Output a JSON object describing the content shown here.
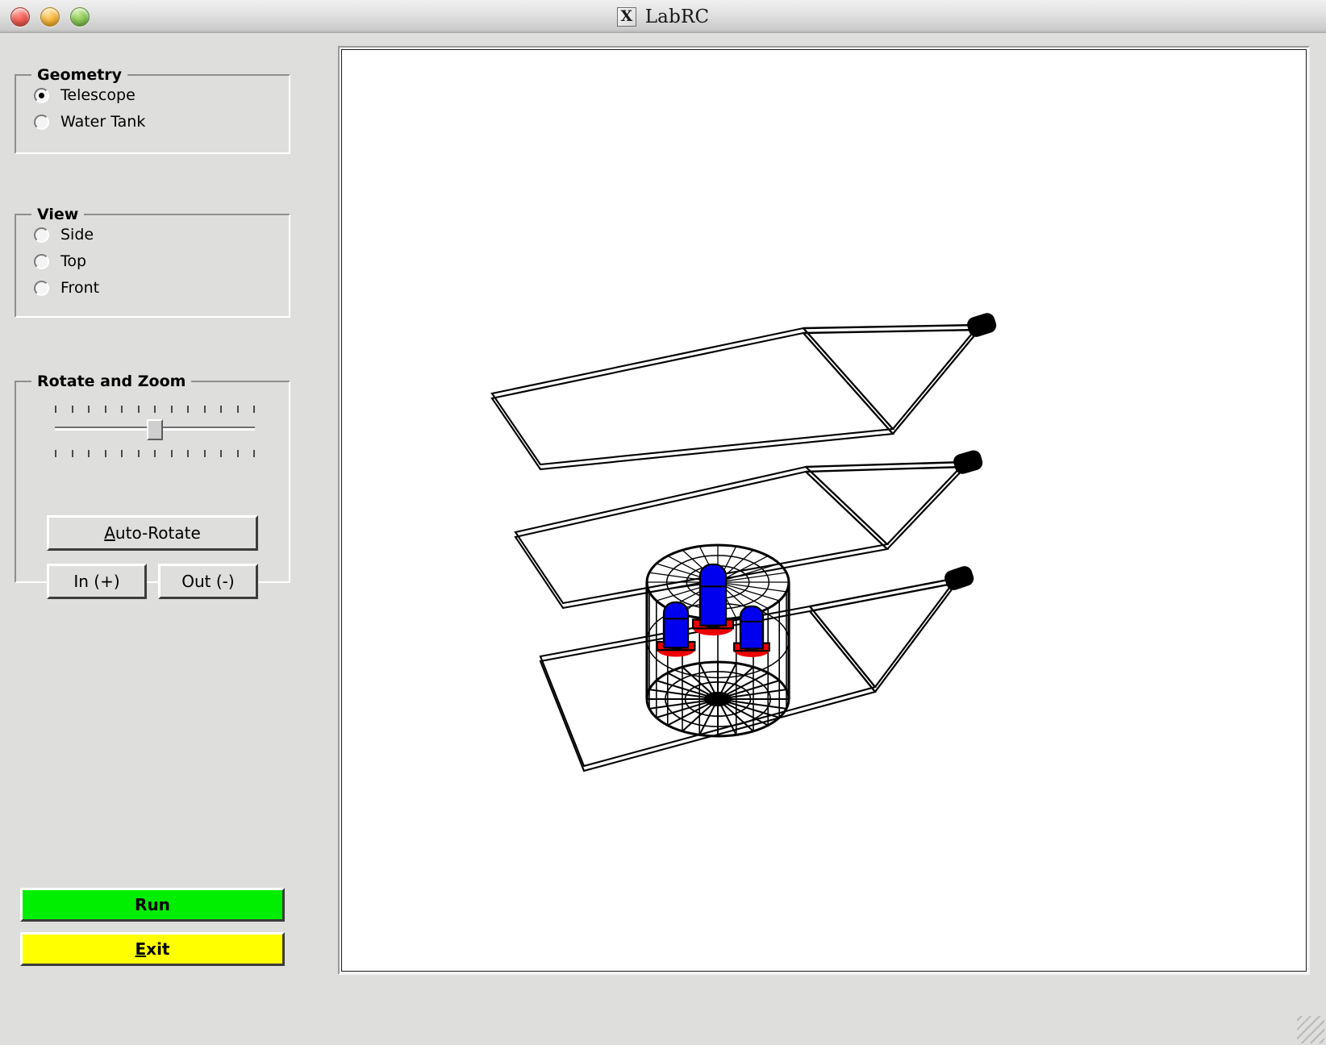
{
  "window": {
    "title": "LabRC",
    "app_icon": "x11-icon",
    "icon_glyph": "X",
    "traffic_lights": [
      {
        "name": "close-button",
        "color": "#ef5f55"
      },
      {
        "name": "minimize-button",
        "color": "#f5b53c"
      },
      {
        "name": "maximize-button",
        "color": "#8cc757"
      }
    ]
  },
  "panel": {
    "geometry": {
      "title": "Geometry",
      "options": [
        {
          "label": "Telescope",
          "selected": true
        },
        {
          "label": "Water Tank",
          "selected": false
        }
      ]
    },
    "view": {
      "title": "View",
      "options": [
        {
          "label": "Side",
          "selected": false
        },
        {
          "label": "Top",
          "selected": false
        },
        {
          "label": "Front",
          "selected": false
        }
      ]
    },
    "rotate_zoom": {
      "title": "Rotate and Zoom",
      "slider": {
        "name": "rotate-zoom-slider",
        "tick_count": 13,
        "value_percent": 50
      },
      "auto_rotate": {
        "label": "Auto-Rotate",
        "mnemonic": "A"
      },
      "zoom_in": {
        "label": "In (+)"
      },
      "zoom_out": {
        "label": "Out (-)"
      }
    },
    "actions": {
      "run": {
        "label": "Run",
        "color": "#00ee00"
      },
      "exit": {
        "label": "Exit",
        "mnemonic": "E",
        "color": "#ffff00"
      }
    }
  },
  "viewport": {
    "name": "3d-scene-canvas",
    "background": "#ffffff",
    "line_color": "#000000",
    "description": "Wireframe 3D view of three fluorescence telescopes and a water-Cherenkov tank",
    "objects": {
      "telescopes": [
        {
          "name": "telescope-upper",
          "mirror_color": "#000000",
          "camera_color": "#000000"
        },
        {
          "name": "telescope-middle",
          "mirror_color": "#000000",
          "camera_color": "#000000"
        },
        {
          "name": "telescope-lower",
          "mirror_color": "#000000",
          "camera_color": "#000000"
        }
      ],
      "water_tank": {
        "name": "water-tank-cylinder",
        "wire_color": "#000000",
        "pmts": [
          {
            "name": "pmt-left",
            "tube_color": "#0000ee",
            "base_color": "#ee0000"
          },
          {
            "name": "pmt-center",
            "tube_color": "#0000ee",
            "base_color": "#ee0000"
          },
          {
            "name": "pmt-right",
            "tube_color": "#0000ee",
            "base_color": "#ee0000"
          }
        ]
      }
    }
  }
}
